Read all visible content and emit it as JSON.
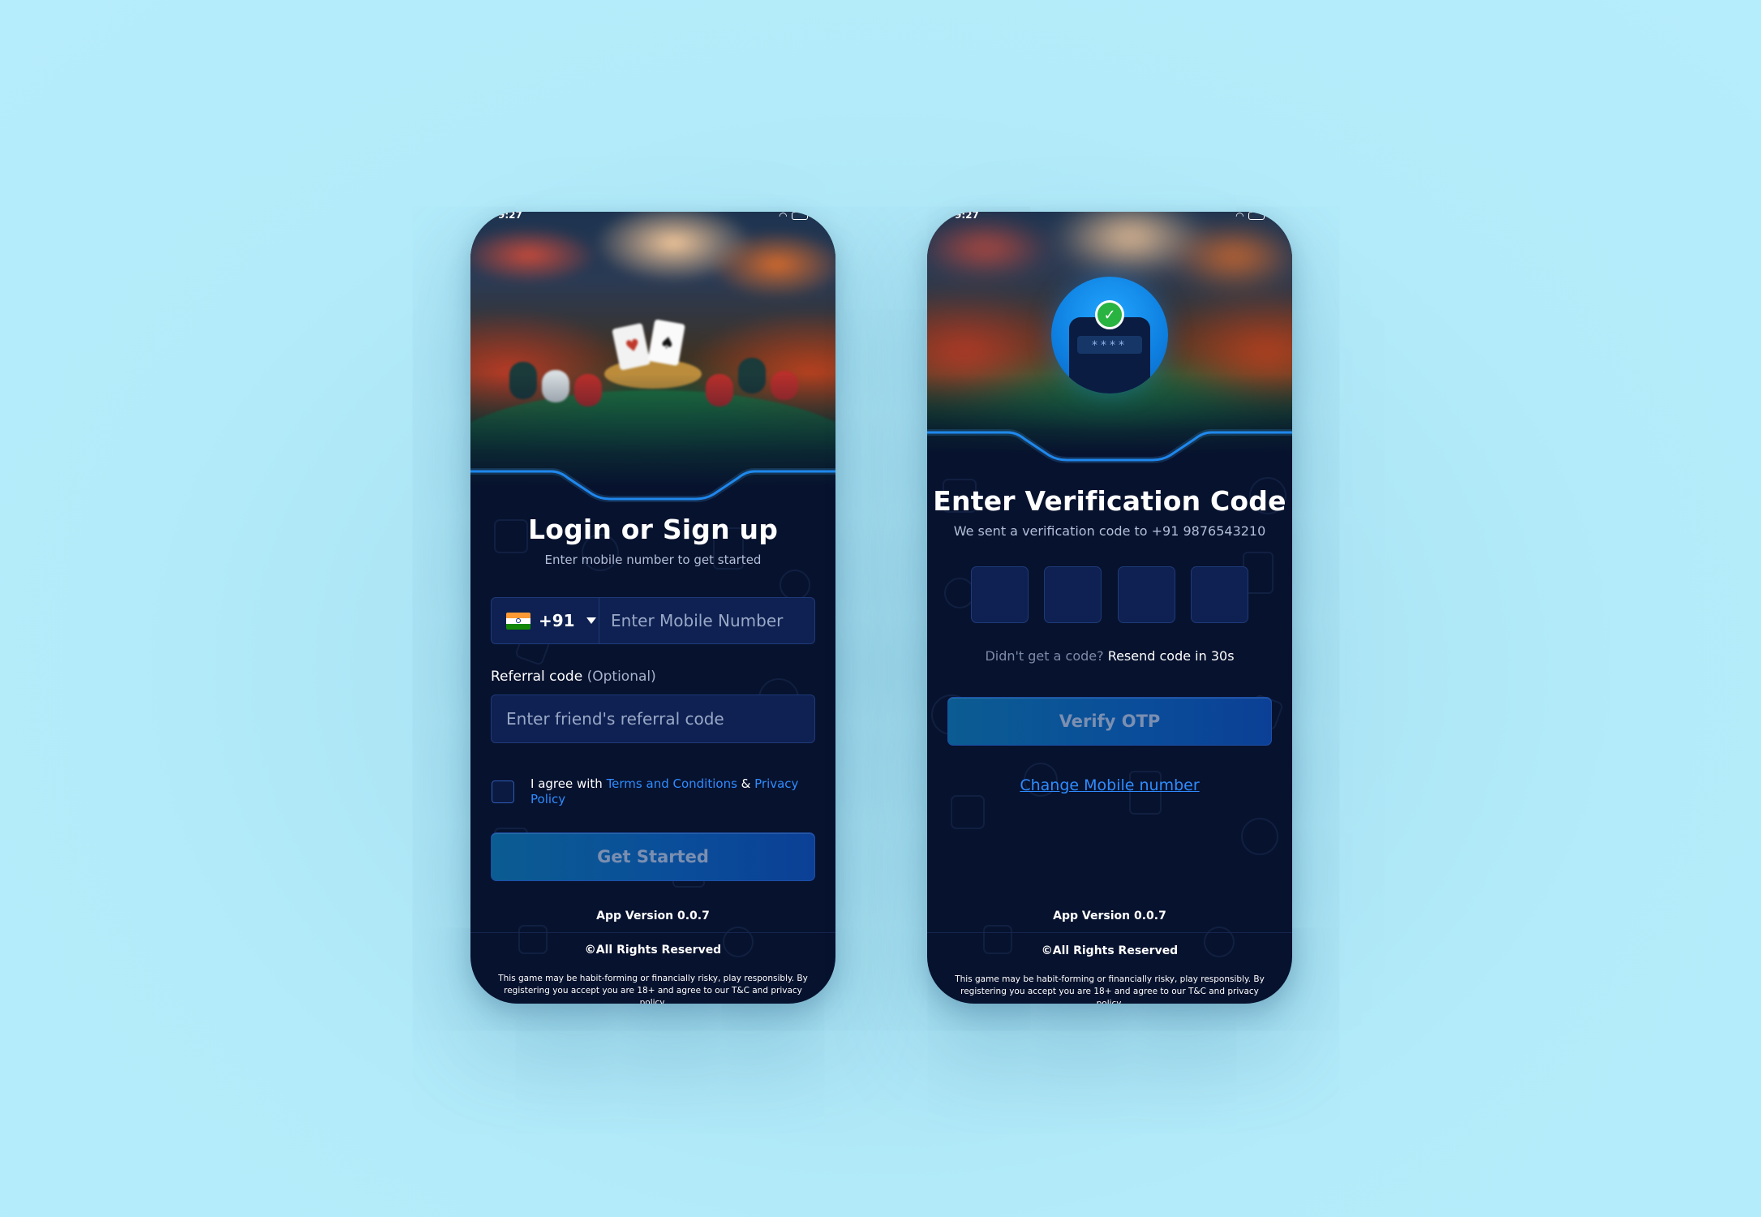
{
  "login_screen": {
    "status_time": "9:27",
    "title": "Login or Sign up",
    "subtitle": "Enter mobile number to get started",
    "country_code": "+91",
    "mobile_placeholder": "Enter Mobile Number",
    "referral_label": "Referral code",
    "referral_optional": "(Optional)",
    "referral_placeholder": "Enter friend's referral code",
    "agree_prefix": "I agree with ",
    "terms_link": "Terms and Conditions",
    "agree_and": " & ",
    "privacy_link": "Privacy Policy",
    "cta_label": "Get Started",
    "app_version": "App Version 0.0.7",
    "rights": "©All Rights Reserved",
    "disclaimer": "This game may be habit-forming or financially risky, play responsibly. By registering you accept you are 18+ and agree to our T&C and privacy policy."
  },
  "otp_screen": {
    "status_time": "9:27",
    "title": "Enter Verification Code",
    "subtitle": "We sent a verification code to +91 9876543210",
    "badge_mask": "****",
    "otp_boxes": [
      "",
      "",
      "",
      ""
    ],
    "resend_prefix": "Didn't get a code? ",
    "resend_timer": "Resend code in 30s",
    "cta_label": "Verify OTP",
    "change_number_link": "Change Mobile number",
    "app_version": "App Version 0.0.7",
    "rights": "©All Rights Reserved",
    "disclaimer": "This game may be habit-forming or financially risky, play responsibly. By registering you accept you are 18+ and agree to our T&C and privacy policy."
  },
  "icons": {
    "flag": "india-flag-icon",
    "dropdown": "chevron-down-icon",
    "check": "check-circle-icon",
    "wifi": "wifi-icon",
    "battery": "battery-icon"
  },
  "colors": {
    "page_background": "#b3ebfa",
    "screen_background": "#07122e",
    "accent_link": "#2f8cff",
    "button_gradient_start": "#0b5c92",
    "button_gradient_end": "#0b4096",
    "success_check": "#29b341"
  }
}
